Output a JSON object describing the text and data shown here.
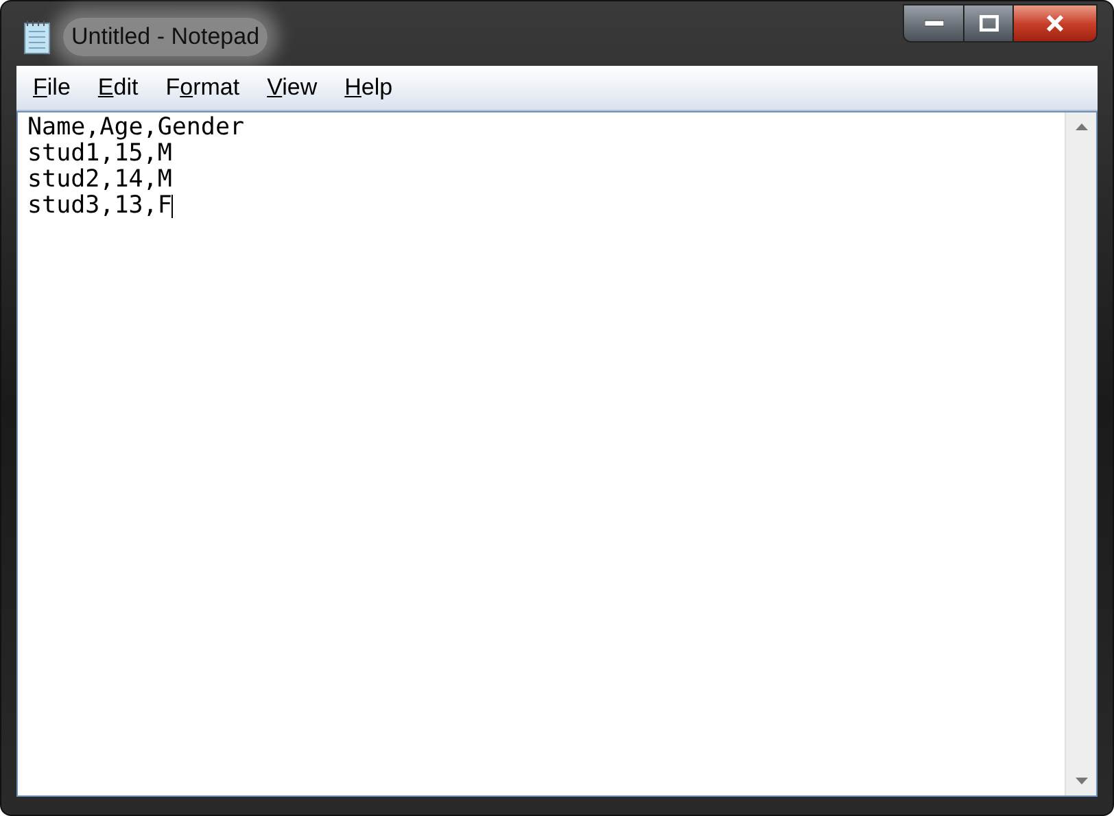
{
  "window": {
    "title": "Untitled - Notepad"
  },
  "menu": [
    {
      "key": "F",
      "after": "ile"
    },
    {
      "key": "E",
      "after": "dit"
    },
    {
      "before": "F",
      "key": "o",
      "after": "rmat"
    },
    {
      "key": "V",
      "after": "iew"
    },
    {
      "key": "H",
      "after": "elp"
    }
  ],
  "editor": {
    "lines": [
      "Name,Age,Gender",
      "stud1,15,M",
      "stud2,14,M",
      "stud3,13,F"
    ]
  }
}
